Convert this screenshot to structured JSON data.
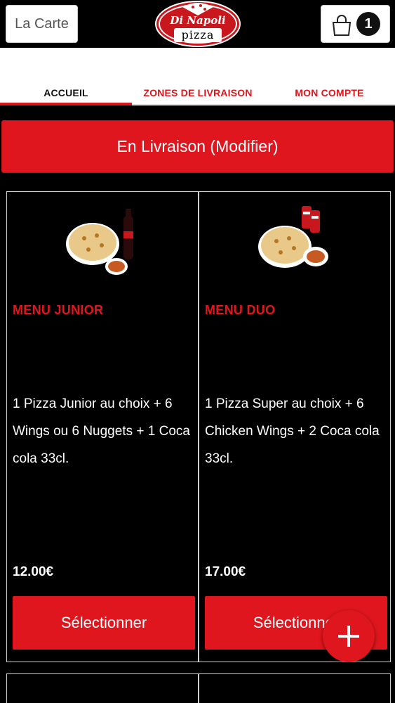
{
  "header": {
    "menu_label": "La Carte",
    "logo_text_line1": "Di Napoli",
    "logo_text_line2": "pizza",
    "cart_count": "1"
  },
  "nav": {
    "tabs": [
      {
        "label": "ACCUEIL",
        "active": true
      },
      {
        "label": "ZONES DE LIVRAISON",
        "active": false
      },
      {
        "label": "MON COMPTE",
        "active": false
      }
    ]
  },
  "delivery": {
    "label": "En Livraison (Modifier)"
  },
  "products": [
    {
      "name": "MENU JUNIOR",
      "description": "1 Pizza Junior au choix  + 6 Wings ou 6 Nuggets  + 1 Coca cola 33cl.",
      "price": "12.00€",
      "select_label": "Sélectionner"
    },
    {
      "name": "MENU DUO",
      "description": "1 Pizza Super au choix  + 6 Chicken Wings  + 2 Coca cola 33cl.",
      "price": "17.00€",
      "select_label": "Sélectionner"
    }
  ],
  "colors": {
    "accent": "#e0161e",
    "background": "#000000",
    "nav_background": "#ffffff"
  },
  "icons": {
    "cart": "shopping-bag-icon",
    "fab": "plus-icon"
  }
}
